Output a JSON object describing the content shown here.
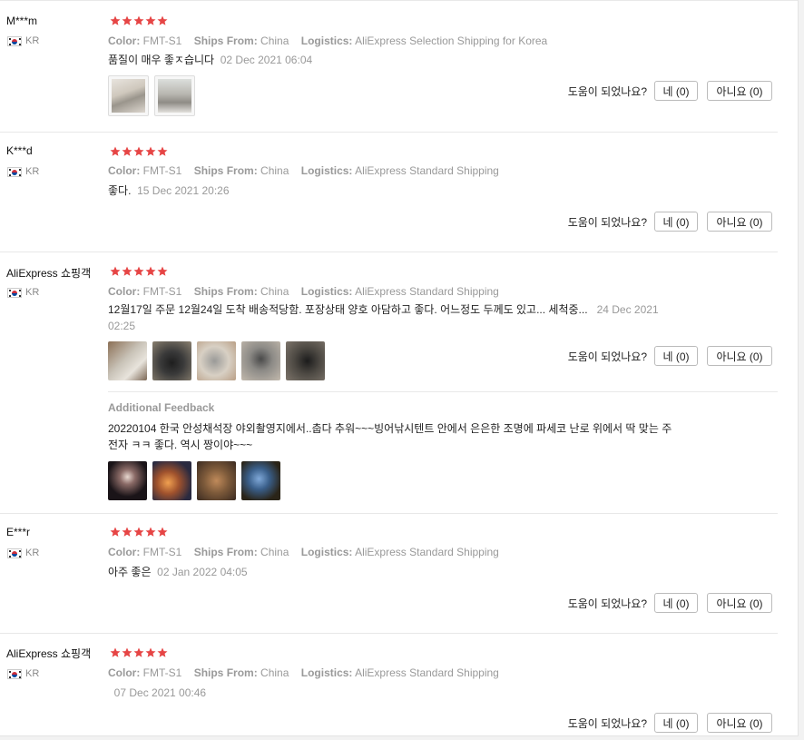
{
  "colors": {
    "star": "#e64545",
    "meta": "#999999"
  },
  "labels": {
    "color": "Color:",
    "ships_from": "Ships From:",
    "logistics": "Logistics:",
    "helpful": "도움이 되었나요?",
    "yes": "네 (0)",
    "no": "아니요 (0)",
    "additional_feedback": "Additional Feedback"
  },
  "reviews": [
    {
      "user": "M***m",
      "country": "KR",
      "rating": 5,
      "color": "FMT-S1",
      "ships_from": "China",
      "logistics": "AliExpress Selection Shipping for Korea",
      "text": "품질이 매우 좋ㅈ습니다",
      "date": "02 Dec 2021 06:04",
      "photos": 2
    },
    {
      "user": "K***d",
      "country": "KR",
      "rating": 5,
      "color": "FMT-S1",
      "ships_from": "China",
      "logistics": "AliExpress Standard Shipping",
      "text": "좋다.",
      "date": "15 Dec 2021 20:26",
      "photos": 0
    },
    {
      "user": "AliExpress 쇼핑객",
      "country": "KR",
      "rating": 5,
      "color": "FMT-S1",
      "ships_from": "China",
      "logistics": "AliExpress Standard Shipping",
      "text": "12월17일 주문 12월24일 도착 배송적당함. 포장상태 양호 아담하고 좋다. 어느정도 두께도 있고... 세척중...",
      "date": "24 Dec 2021 02:25",
      "photos": 5,
      "additional_text": "20220104 한국 안성채석장 야외촬영지에서..춥다 추워~~~빙어낚시텐트 안에서 은은한 조명에 파세코 난로 위에서 딱 맞는 주전자 ㅋㅋ 좋다. 역시 짱이야~~~",
      "additional_photos": 4
    },
    {
      "user": "E***r",
      "country": "KR",
      "rating": 5,
      "color": "FMT-S1",
      "ships_from": "China",
      "logistics": "AliExpress Standard Shipping",
      "text": "아주 좋은",
      "date": "02 Jan 2022 04:05",
      "photos": 0
    },
    {
      "user": "AliExpress 쇼핑객",
      "country": "KR",
      "rating": 5,
      "color": "FMT-S1",
      "ships_from": "China",
      "logistics": "AliExpress Standard Shipping",
      "text": "",
      "date": "07 Dec 2021 00:46",
      "photos": 0
    }
  ]
}
